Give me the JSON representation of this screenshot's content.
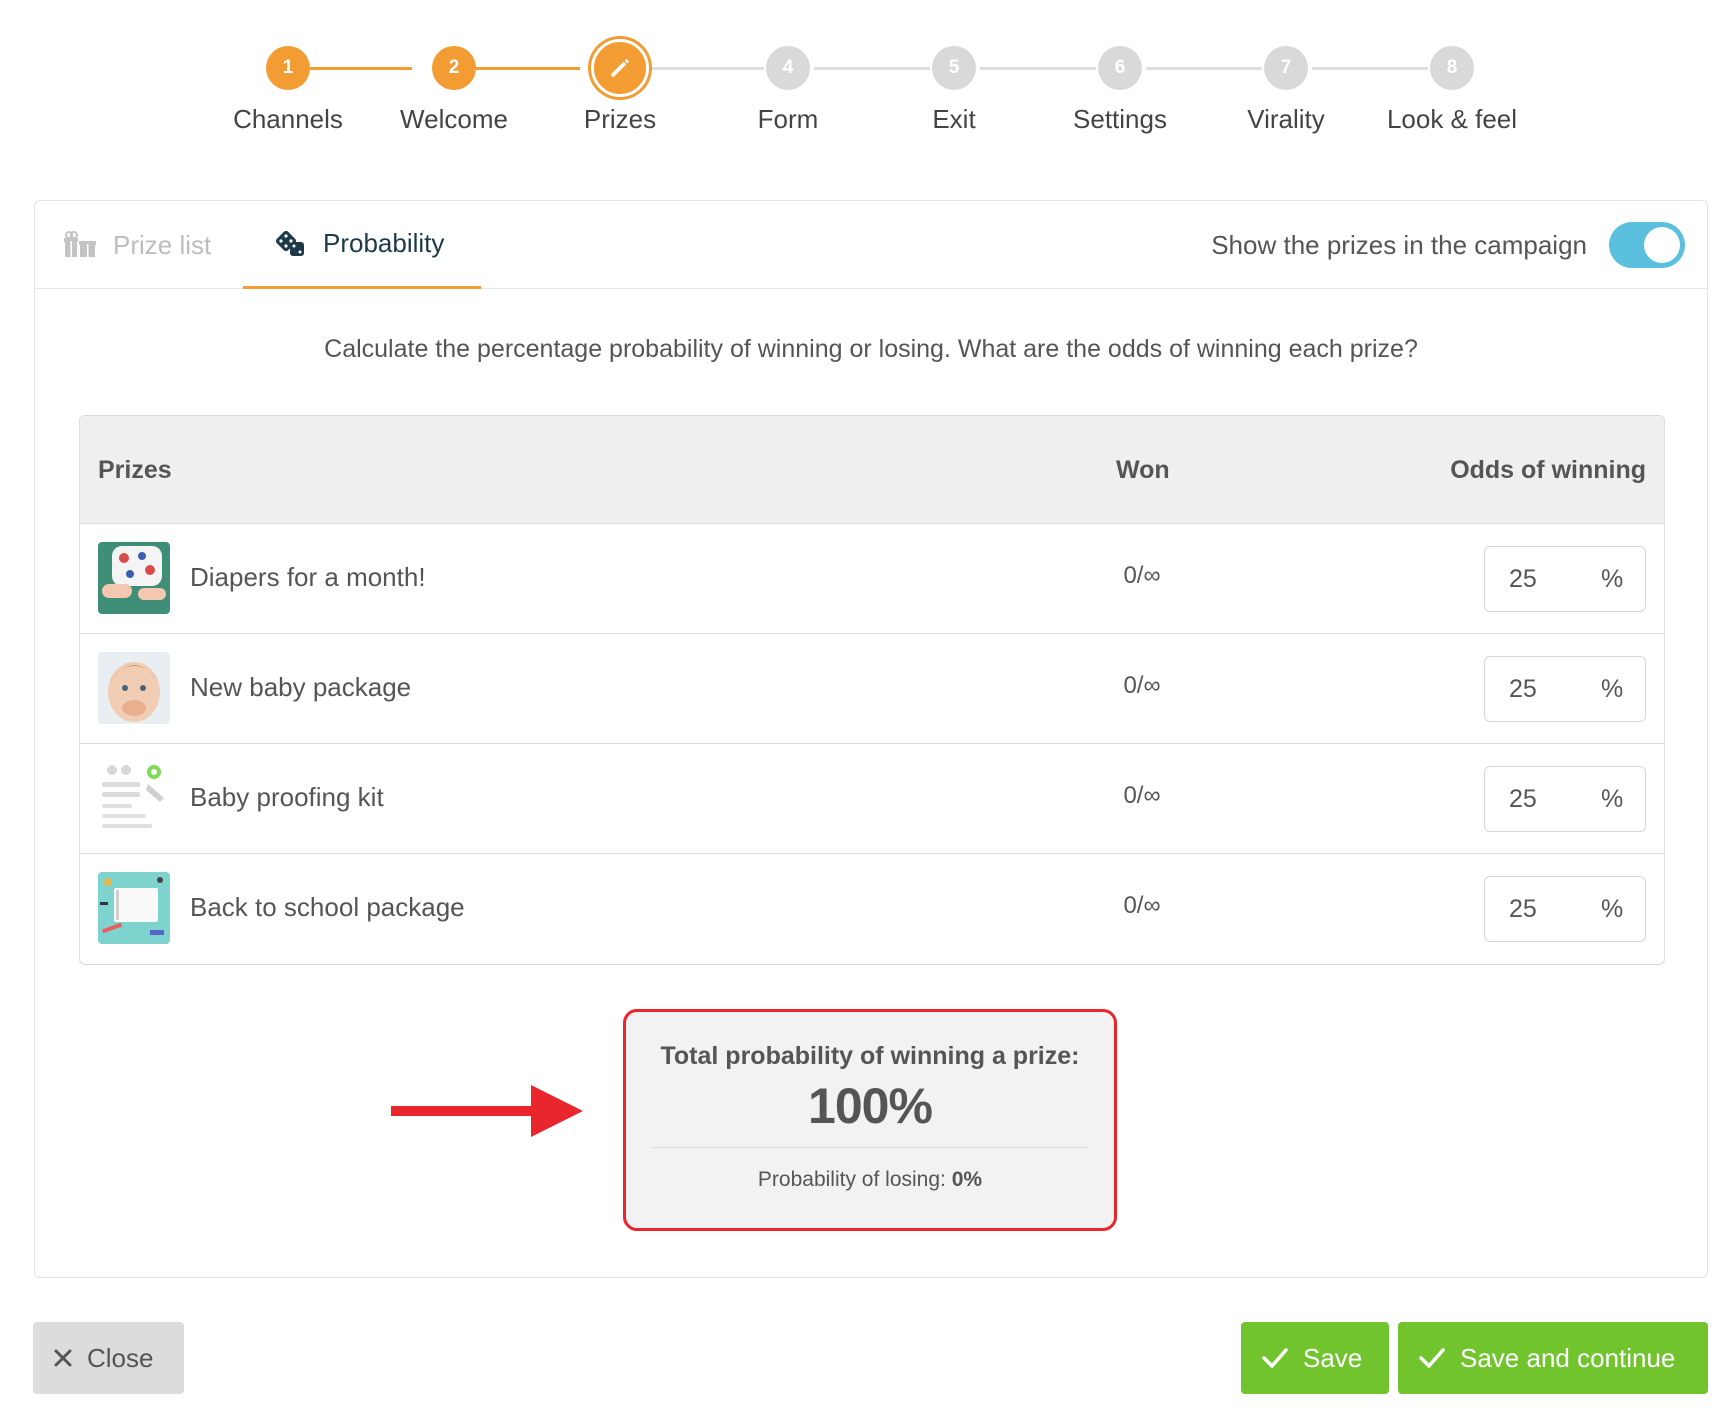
{
  "stepper": {
    "steps": [
      {
        "number": "1",
        "label": "Channels",
        "state": "done"
      },
      {
        "number": "2",
        "label": "Welcome",
        "state": "done"
      },
      {
        "number": "3",
        "label": "Prizes",
        "state": "current"
      },
      {
        "number": "4",
        "label": "Form",
        "state": "todo"
      },
      {
        "number": "5",
        "label": "Exit",
        "state": "todo"
      },
      {
        "number": "6",
        "label": "Settings",
        "state": "todo"
      },
      {
        "number": "7",
        "label": "Virality",
        "state": "todo"
      },
      {
        "number": "8",
        "label": "Look & feel",
        "state": "todo"
      }
    ]
  },
  "tabs": {
    "prize_list": "Prize list",
    "probability": "Probability",
    "active": "probability"
  },
  "toggle": {
    "label": "Show the prizes in the campaign",
    "on": true
  },
  "intro": "Calculate the percentage probability of winning or losing. What are the odds of winning each prize?",
  "table": {
    "headers": {
      "prizes": "Prizes",
      "won": "Won",
      "odds": "Odds of winning"
    },
    "rows": [
      {
        "name": "Diapers for a month!",
        "won": "0/∞",
        "odds": "25",
        "unit": "%"
      },
      {
        "name": "New baby package",
        "won": "0/∞",
        "odds": "25",
        "unit": "%"
      },
      {
        "name": "Baby proofing kit",
        "won": "0/∞",
        "odds": "25",
        "unit": "%"
      },
      {
        "name": "Back to school package",
        "won": "0/∞",
        "odds": "25",
        "unit": "%"
      }
    ]
  },
  "summary": {
    "title": "Total probability of winning a prize:",
    "value": "100%",
    "losing_label": "Probability of losing:",
    "losing_value": "0%"
  },
  "footer": {
    "close": "Close",
    "save": "Save",
    "save_continue": "Save and continue"
  },
  "colors": {
    "accent": "#f39c33",
    "toggle": "#5bc0de",
    "success": "#72c42f",
    "highlight": "#e8262b"
  }
}
